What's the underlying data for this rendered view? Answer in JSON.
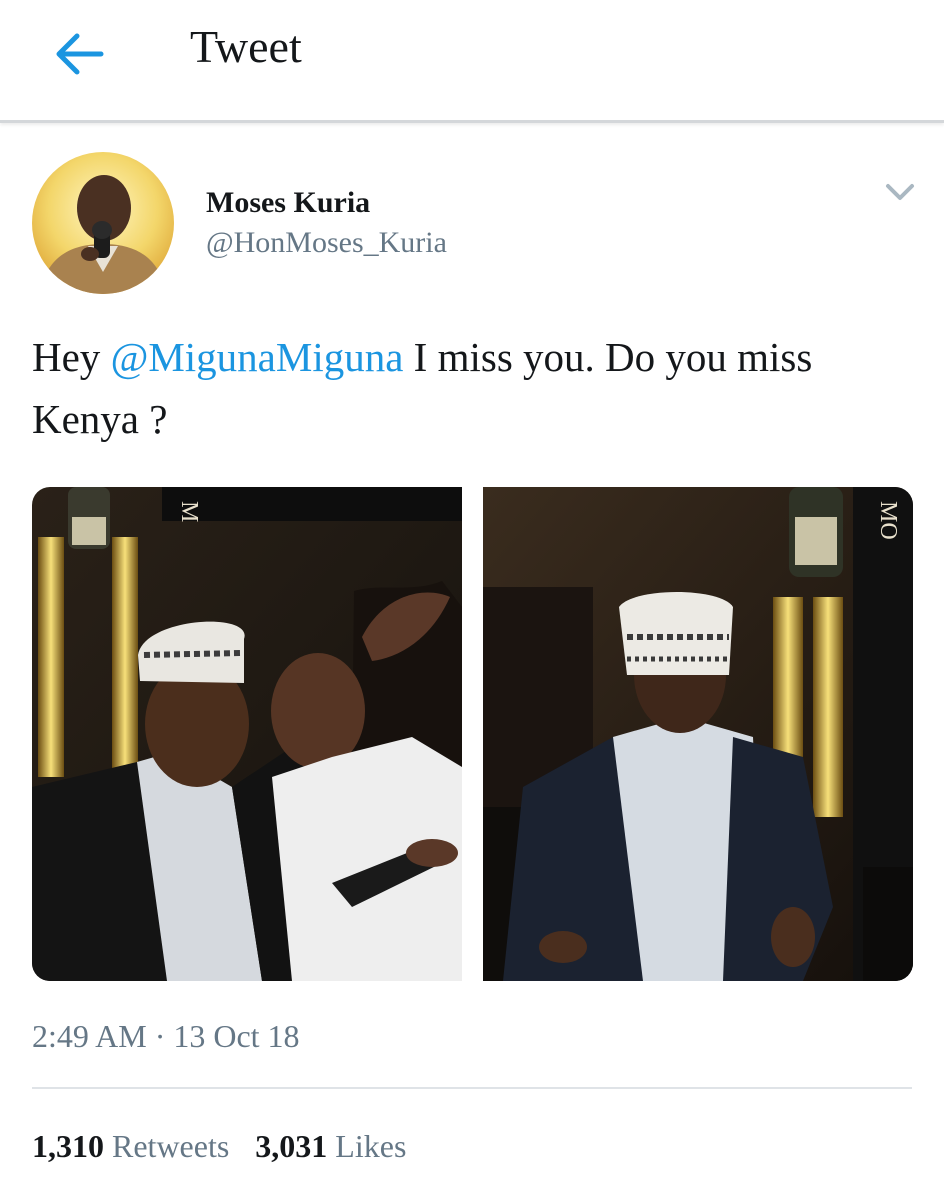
{
  "header": {
    "title": "Tweet",
    "back_icon": "arrow-left-icon"
  },
  "tweet": {
    "author": {
      "name": "Moses Kuria",
      "handle": "@HonMoses_Kuria"
    },
    "menu_icon": "chevron-down-icon",
    "text_prefix": "Hey ",
    "mention": "@MigunaMiguna",
    "text_suffix": " I miss you. Do you miss Kenya ?",
    "photos": [
      {
        "sign_text": "M"
      },
      {
        "sign_text": "MO"
      }
    ],
    "timestamp": "2:49 AM · 13 Oct 18",
    "stats": {
      "retweets_count": "1,310",
      "retweets_label": "Retweets",
      "likes_count": "3,031",
      "likes_label": "Likes"
    }
  },
  "colors": {
    "accent": "#1b95e0",
    "secondary_text": "#657786",
    "primary_text": "#14171a"
  }
}
